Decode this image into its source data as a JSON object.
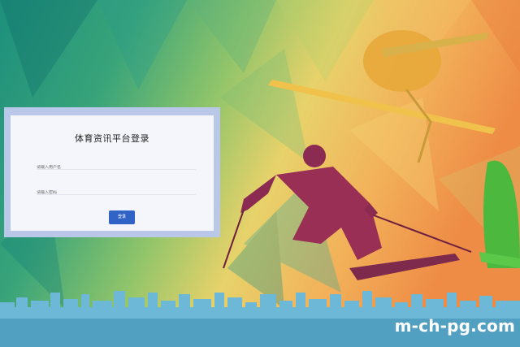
{
  "login": {
    "title": "体育资讯平台登录",
    "username_placeholder": "请输入用户名",
    "password_placeholder": "请输入密码",
    "login_button": "登录"
  },
  "watermark": "m-ch-pg.com",
  "colors": {
    "button": "#2f63c6",
    "frame": "#b9c8e8",
    "card": "#f4f6fb"
  }
}
